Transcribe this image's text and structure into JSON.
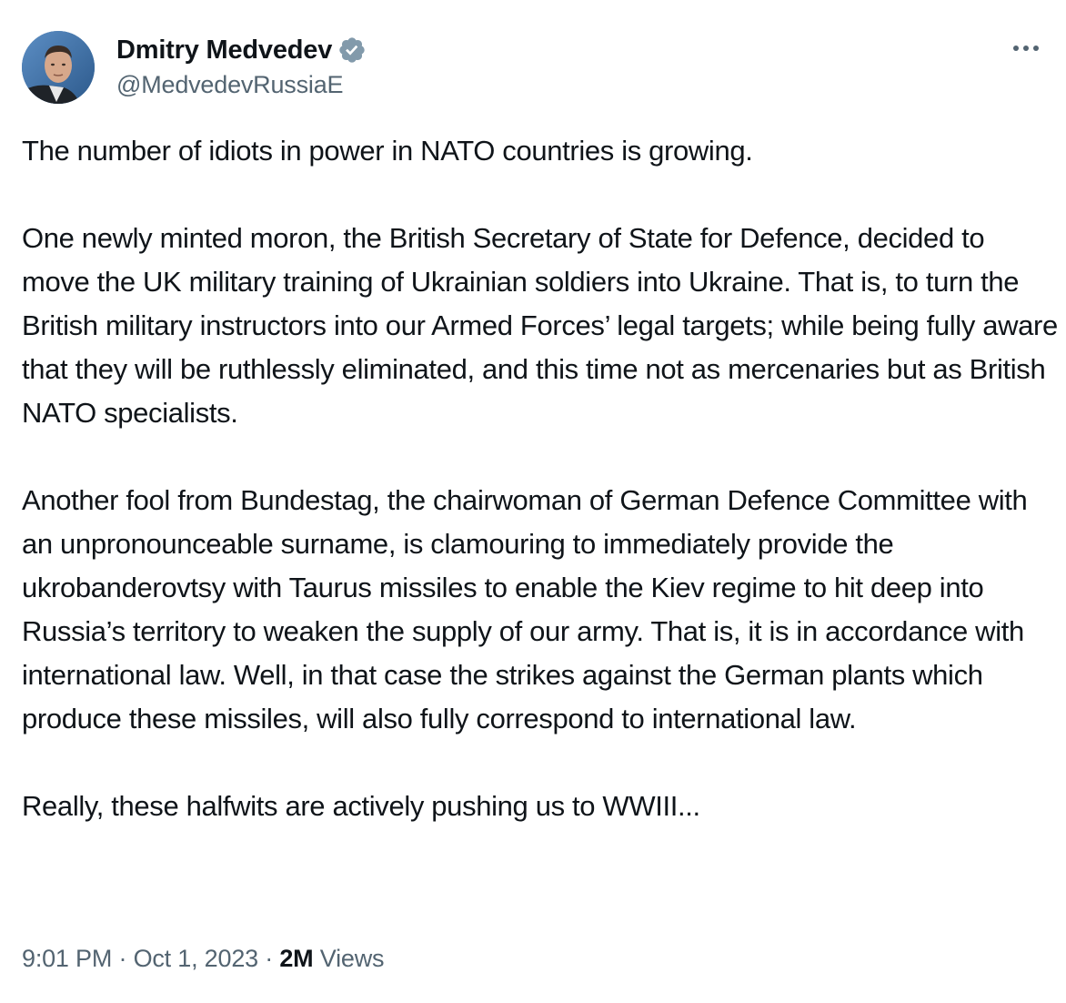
{
  "author": {
    "display_name": "Dmitry Medvedev",
    "handle": "@MedvedevRussiaE",
    "verified_badge": "verified-badge-icon",
    "avatar": "profile-photo"
  },
  "more_menu": {
    "icon": "more-horizontal-icon"
  },
  "tweet": {
    "paragraphs": [
      "The number of idiots in power in NATO countries is growing.",
      "One newly minted moron, the British Secretary of State for Defence, decided to move the UK military training of Ukrainian soldiers into Ukraine. That is, to turn the British military instructors into our Armed Forces’ legal targets; while being fully aware that they will be ruthlessly eliminated, and this time not as mercenaries but as British NATO specialists.",
      "Another fool from Bundestag, the chairwoman of German Defence Committee with an unpronounceable surname, is clamouring to immediately provide the ukrobanderovtsy with Taurus missiles to enable the Kiev regime to hit deep into Russia’s territory to weaken the supply of our army. That is, it is in accordance with international law. Well, in that case the strikes against the German plants which produce these missiles, will also fully correspond to international law.",
      "Really, these halfwits are actively pushing us to WWIII..."
    ]
  },
  "meta": {
    "time": "9:01 PM",
    "separator": " · ",
    "date": "Oct 1, 2023",
    "views_count": "2M",
    "views_label": "Views"
  },
  "colors": {
    "text_primary": "#0f1419",
    "text_secondary": "#536471",
    "verified_gray": "#829aab"
  }
}
